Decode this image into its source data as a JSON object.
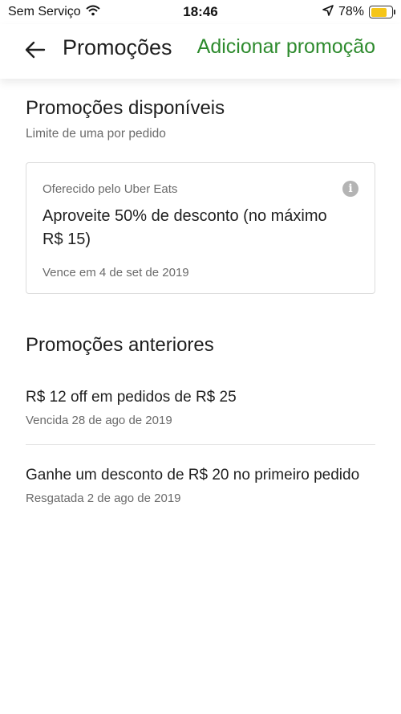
{
  "status_bar": {
    "carrier": "Sem Serviço",
    "time": "18:46",
    "battery_percent": "78%",
    "battery_level": 0.78,
    "battery_color": "#f5c518",
    "icons": [
      "wifi-icon",
      "location-arrow-icon",
      "battery-icon"
    ]
  },
  "header": {
    "back_icon": "arrow-left-icon",
    "title": "Promoções",
    "action_label": "Adicionar promoção",
    "accent_color": "#2e8b2e"
  },
  "available": {
    "title": "Promoções disponíveis",
    "subtitle": "Limite de uma por pedido",
    "card": {
      "offered_by": "Oferecido pelo Uber Eats",
      "info_icon": "info-icon",
      "info_glyph": "i",
      "title": "Aproveite 50% de desconto (no máximo R$ 15)",
      "expiry": "Vence em 4 de set de 2019"
    }
  },
  "past": {
    "title": "Promoções anteriores",
    "items": [
      {
        "title": "R$ 12 off em pedidos de R$ 25",
        "subtitle": "Vencida 28 de ago de 2019"
      },
      {
        "title": "Ganhe um desconto de R$ 20 no primeiro pedido",
        "subtitle": "Resgatada 2 de ago de 2019"
      }
    ]
  }
}
